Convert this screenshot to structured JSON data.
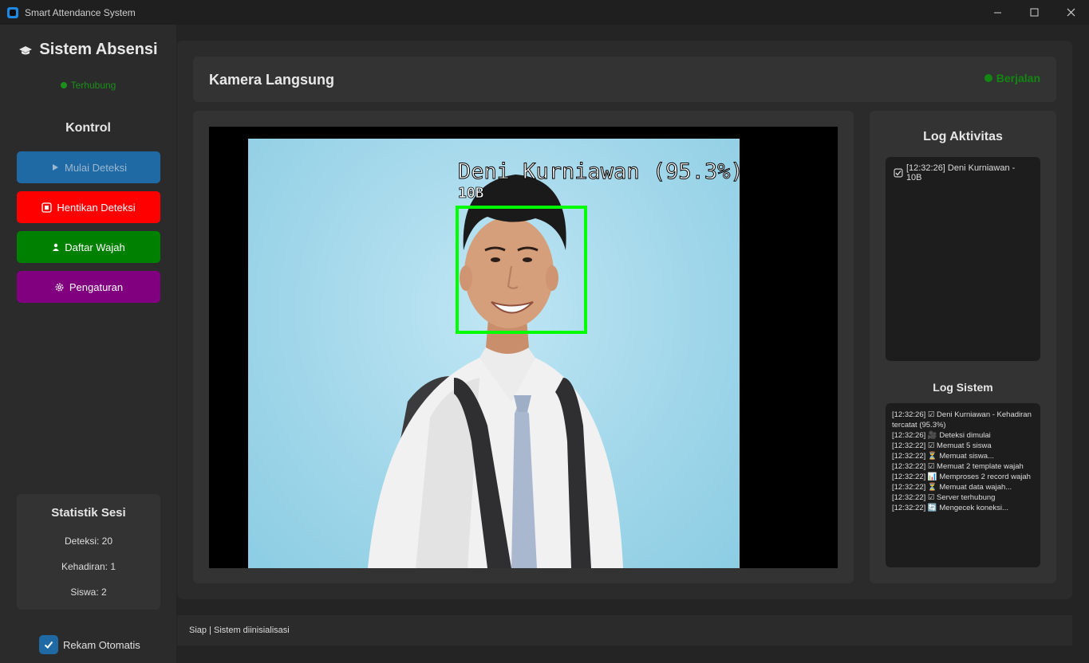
{
  "window": {
    "title": "Smart Attendance System",
    "minimize": "—",
    "maximize": "☐",
    "close": "✕"
  },
  "sidebar": {
    "title": "Sistem Absensi",
    "connection": "Terhubung",
    "control_title": "Kontrol",
    "buttons": {
      "start": "Mulai Deteksi",
      "stop": "Hentikan Deteksi",
      "register": "Daftar Wajah",
      "settings": "Pengaturan"
    },
    "stats": {
      "title": "Statistik Sesi",
      "detections": "Deteksi: 20",
      "attendance": "Kehadiran: 1",
      "students": "Siswa: 2"
    },
    "auto_record": "Rekam Otomatis"
  },
  "header": {
    "title": "Kamera Langsung",
    "status": "Berjalan"
  },
  "camera": {
    "label_name": "Deni Kurniawan (95.3%)",
    "label_class": "10B"
  },
  "activity_log": {
    "title": "Log Aktivitas",
    "entries": [
      "[12:32:26] Deni Kurniawan - 10B"
    ]
  },
  "system_log": {
    "title": "Log Sistem",
    "entries": [
      "[12:32:26] ☑ Deni Kurniawan - Kehadiran tercatat (95.3%)",
      "[12:32:26] 🎥 Deteksi dimulai",
      "[12:32:22] ☑ Memuat 5 siswa",
      "[12:32:22] ⏳ Memuat siswa...",
      "[12:32:22] ☑ Memuat 2 template wajah",
      "[12:32:22] 📊 Memproses 2 record wajah",
      "[12:32:22] ⏳ Memuat data wajah...",
      "[12:32:22] ☑ Server terhubung",
      "[12:32:22] 🔄 Mengecek koneksi..."
    ]
  },
  "footer": {
    "status": "Siap | Sistem diinisialisasi"
  },
  "colors": {
    "start": "#1f6aa5",
    "stop": "#ff0000",
    "register": "#008000",
    "settings": "#800080",
    "running": "#128712",
    "face_box": "#00ff00"
  },
  "icons": {
    "app": "app-icon",
    "brand": "graduation-cap-icon",
    "start": "play-icon",
    "stop": "stop-icon",
    "register": "person-icon",
    "settings": "gear-icon",
    "checkbox": "check-icon"
  }
}
